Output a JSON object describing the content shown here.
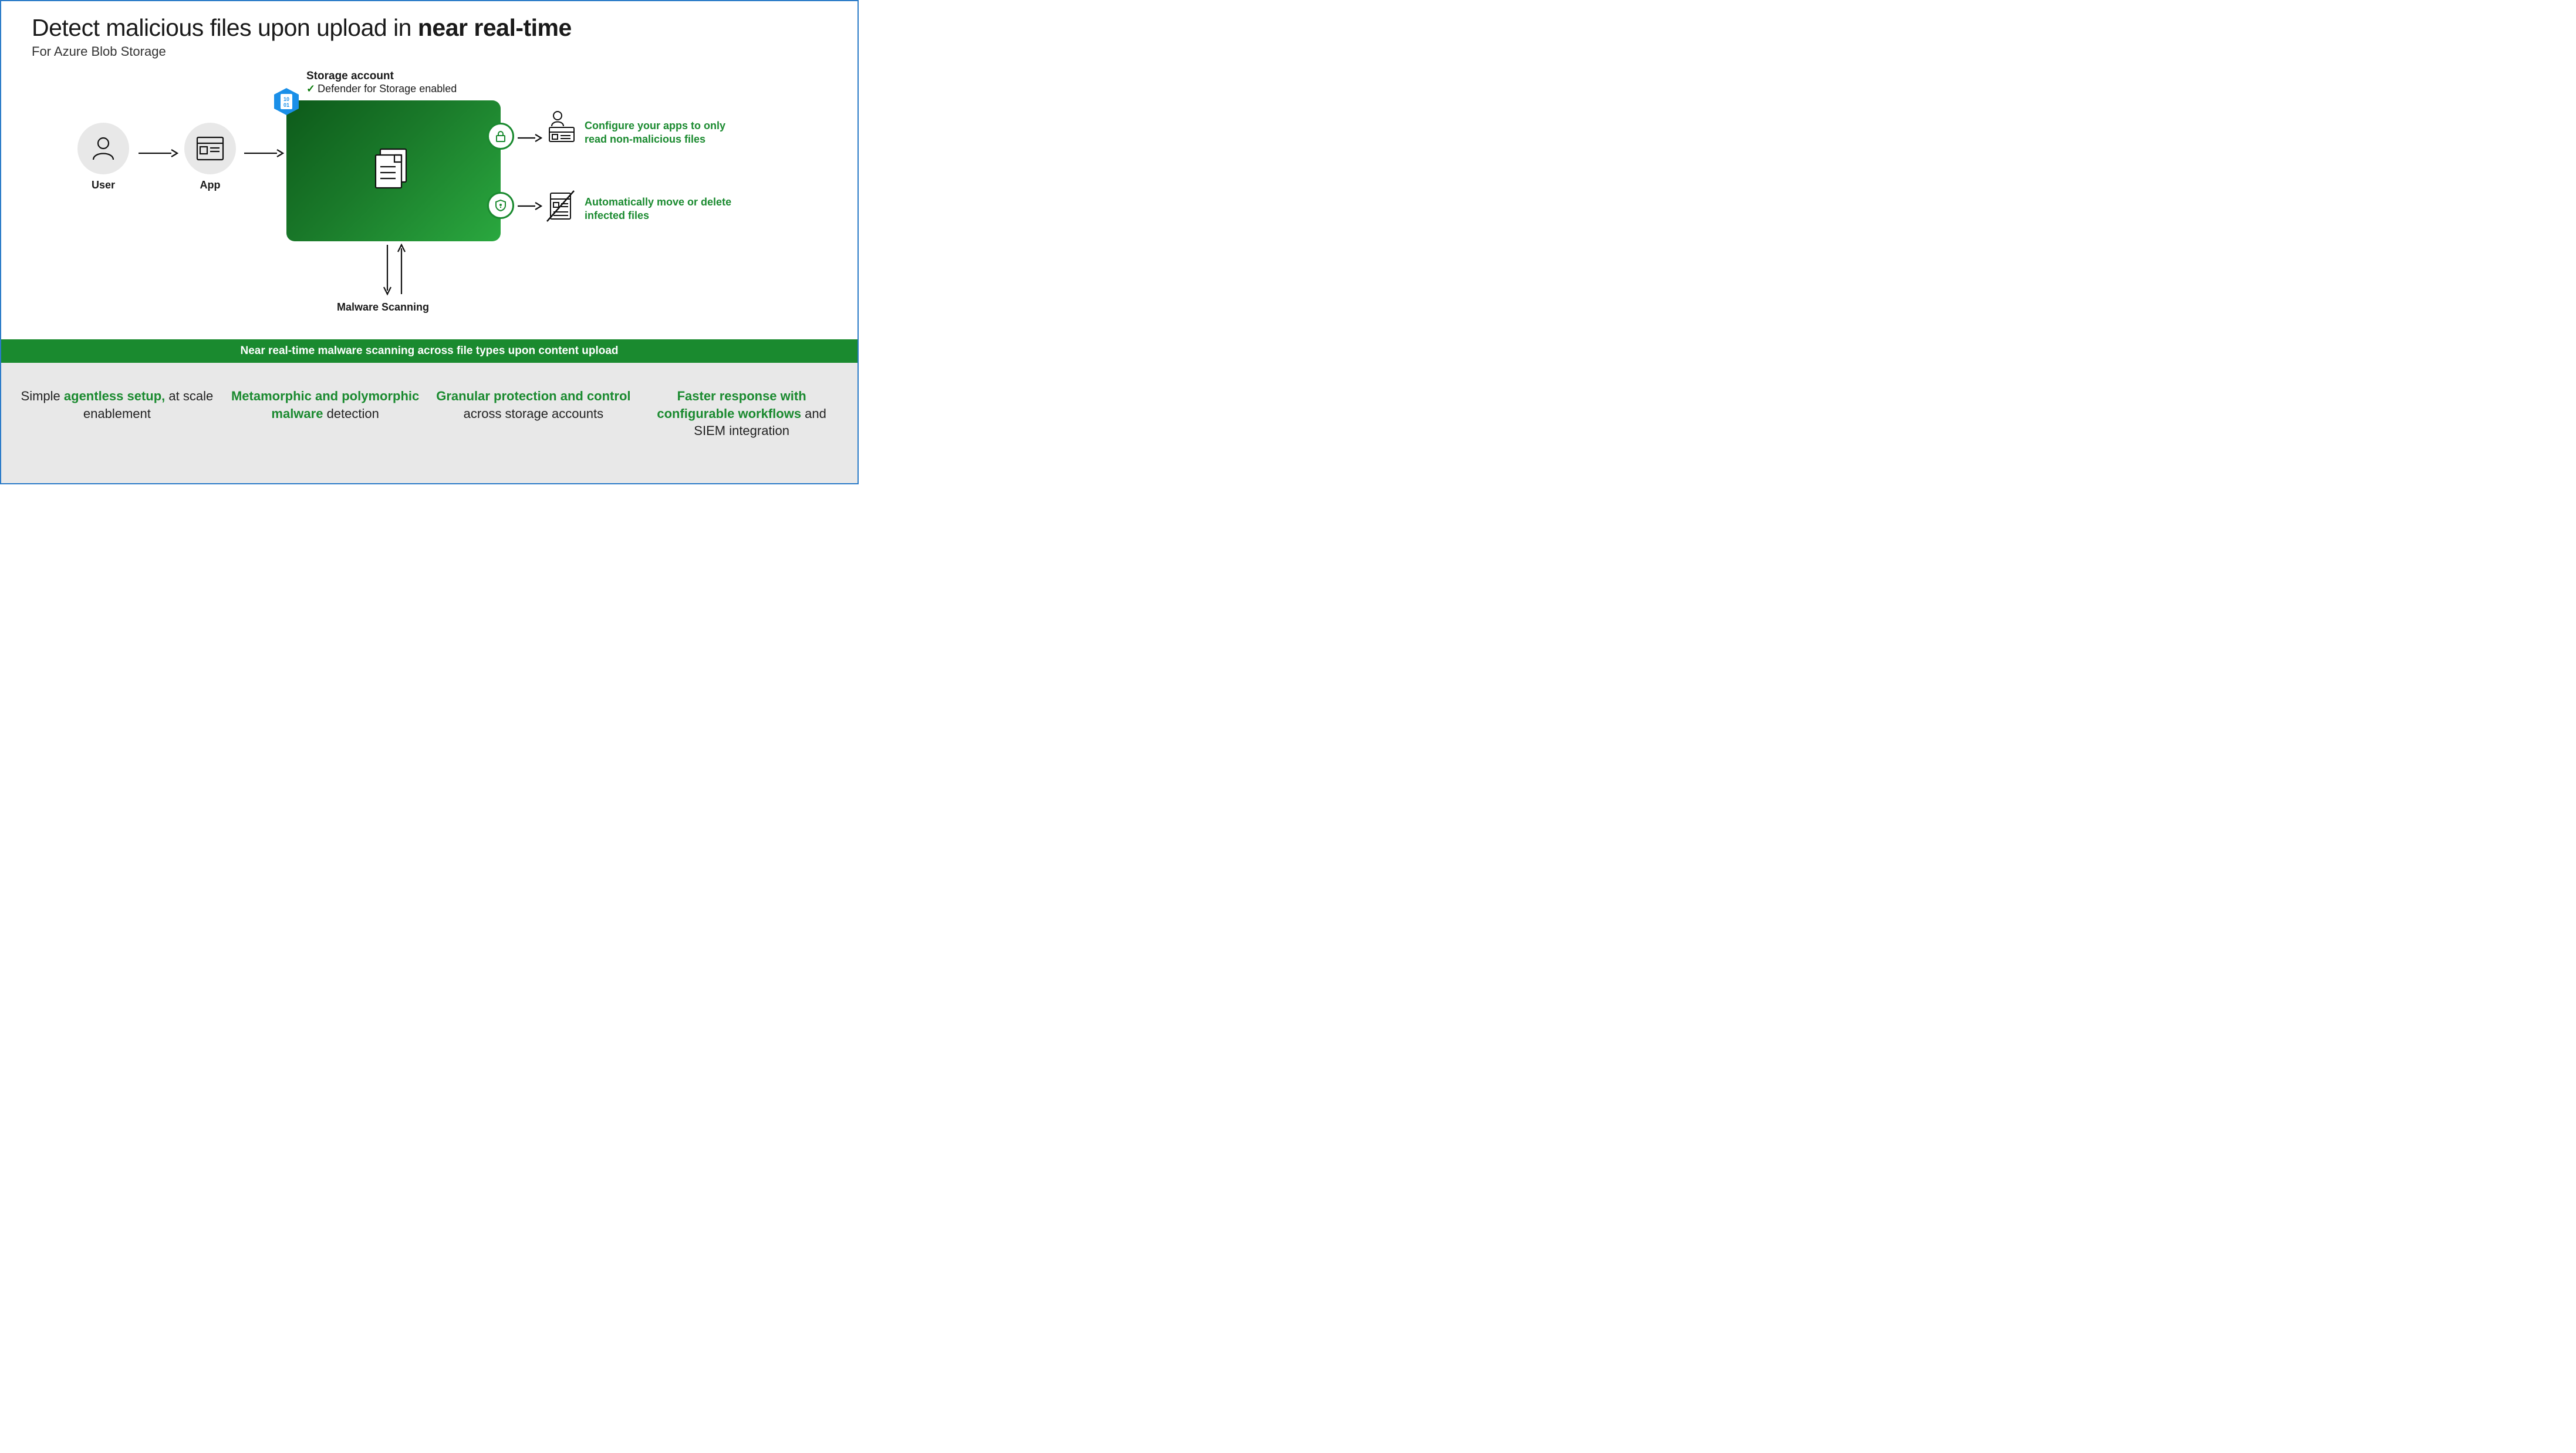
{
  "header": {
    "title_plain": "Detect malicious files upon upload in ",
    "title_bold": "near real-time",
    "subtitle": "For Azure Blob Storage"
  },
  "diagram": {
    "user_label": "User",
    "app_label": "App",
    "storage_title": "Storage account",
    "storage_check": "✓",
    "storage_status": "Defender for Storage enabled",
    "hex_text": "10\n01",
    "malware_label": "Malware Scanning",
    "out1": "Configure your apps to only read non-malicious files",
    "out2": "Automatically move or delete infected files"
  },
  "banner": "Near real-time malware scanning across file types upon content upload",
  "features": [
    {
      "pre": "Simple ",
      "bold": "agentless setup,",
      "post": " at scale enablement"
    },
    {
      "pre": "",
      "bold": "Metamorphic and polymorphic malware",
      "post": " detection"
    },
    {
      "pre": "",
      "bold": "Granular protection and control",
      "post": " across storage accounts"
    },
    {
      "pre": "",
      "bold": "Faster response with configurable workflows",
      "post": " and SIEM integration"
    }
  ]
}
